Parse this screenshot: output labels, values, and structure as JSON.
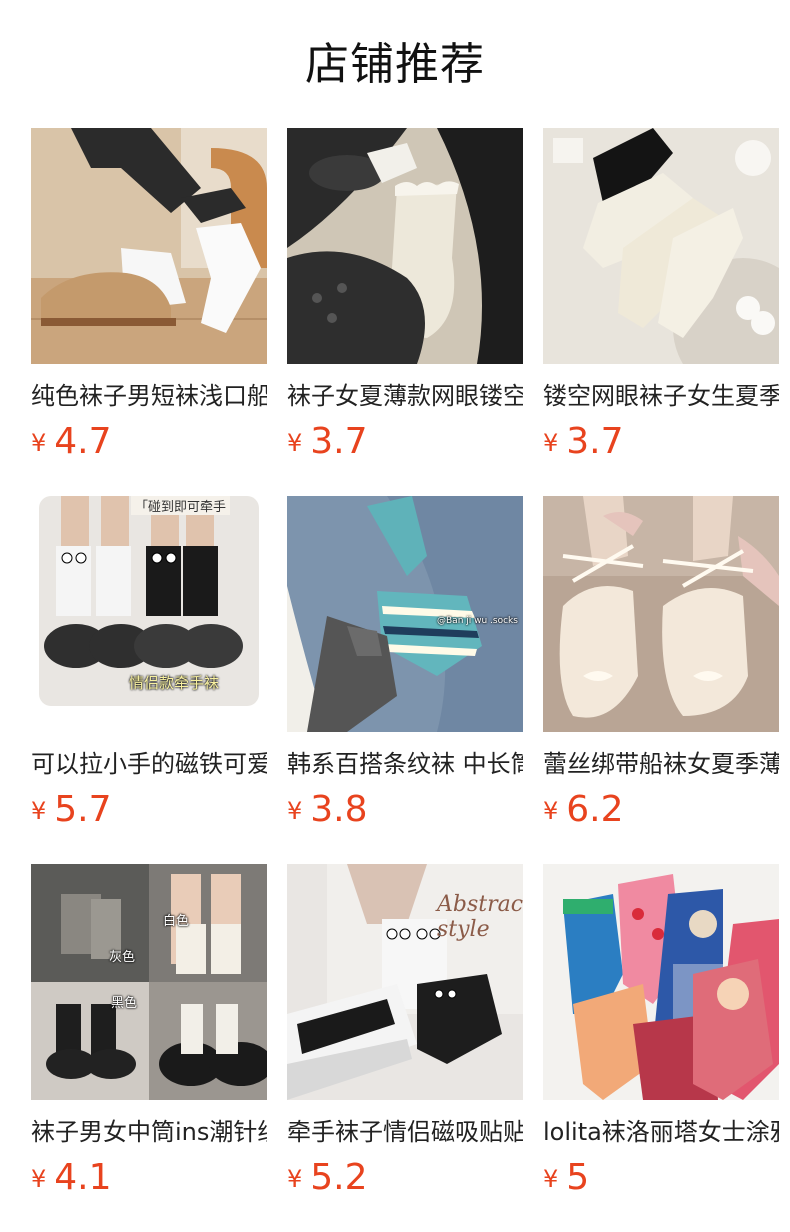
{
  "section": {
    "title": "店铺推荐"
  },
  "products": [
    {
      "title": "纯色袜子男短袜浅口船袜",
      "currency": "¥",
      "price": "4.7",
      "image": "white-ankle-sock-photo"
    },
    {
      "title": "袜子女夏薄款网眼镂空中筒袜",
      "currency": "¥",
      "price": "3.7",
      "image": "cream-ruffle-sock-photo"
    },
    {
      "title": "镂空网眼袜子女生夏季薄款",
      "currency": "¥",
      "price": "3.7",
      "image": "lace-mesh-socks-photo"
    },
    {
      "title": "可以拉小手的磁铁可爱情侣袜",
      "currency": "¥",
      "price": "5.7",
      "image": "magnet-couple-socks-photo",
      "overlay_top": "「碰到即可牵手",
      "overlay_bottom": "情侣款牵手袜"
    },
    {
      "title": "韩系百搭条纹袜 中长筒袜",
      "currency": "¥",
      "price": "3.8",
      "image": "striped-socks-photo",
      "overlay": "@Ban ji wu .socks"
    },
    {
      "title": "蕾丝绑带船袜女夏季薄款",
      "currency": "¥",
      "price": "6.2",
      "image": "ribbon-boat-socks-photo"
    },
    {
      "title": "袜子男女中筒ins潮针织堆堆袜",
      "currency": "¥",
      "price": "4.1",
      "image": "slouch-socks-collage-photo",
      "labels": [
        "白色",
        "灰色",
        "黑色"
      ]
    },
    {
      "title": "牵手袜子情侣磁吸贴贴袜",
      "currency": "¥",
      "price": "5.2",
      "image": "hand-holding-socks-photo",
      "overlay": "Abstract style"
    },
    {
      "title": "lolita袜洛丽塔女士涂鸦卡通袜",
      "currency": "¥",
      "price": "5",
      "image": "cartoon-crew-socks-photo"
    }
  ],
  "colors": {
    "price": "#e8431e",
    "title": "#222222"
  }
}
